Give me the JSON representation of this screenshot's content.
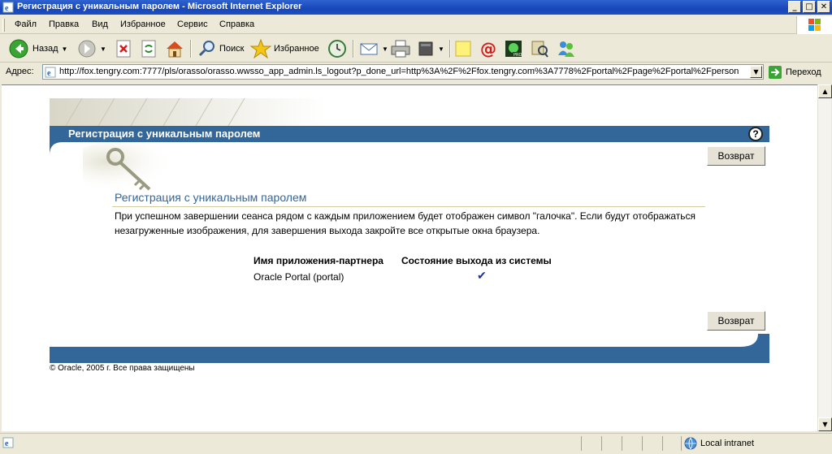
{
  "window": {
    "title": "Регистрация с уникальным паролем - Microsoft Internet Explorer",
    "controls": {
      "minimize": "_",
      "maximize": "□",
      "close": "✕"
    }
  },
  "menu": {
    "items": [
      "Файл",
      "Правка",
      "Вид",
      "Избранное",
      "Сервис",
      "Справка"
    ]
  },
  "toolbar": {
    "back_label": "Назад",
    "search_label": "Поиск",
    "favorites_label": "Избранное"
  },
  "address": {
    "label": "Адрес:",
    "url": "http://fox.tengry.com:7777/pls/orasso/orasso.wwsso_app_admin.ls_logout?p_done_url=http%3A%2F%2Ffox.tengry.com%3A7778%2Fportal%2Fpage%2Fportal%2Fperson",
    "go_label": "Переход"
  },
  "page": {
    "banner_title": "Регистрация с уникальным паролем",
    "help_glyph": "?",
    "back_button_label": "Возврат",
    "heading": "Регистрация с уникальным паролем",
    "description": "При успешном завершении сеанса рядом с каждым приложением будет отображен символ \"галочка\". Если будут отображаться незагруженные изображения, для завершения выхода закройте все открытые окна браузера.",
    "table": {
      "headers": [
        "Имя приложения-партнера",
        "Состояние выхода из системы"
      ],
      "rows": [
        {
          "app": "Oracle Portal (portal)",
          "status_glyph": "✔"
        }
      ]
    },
    "copyright": "© Oracle, 2005 г. Все права защищены"
  },
  "status": {
    "zone": "Local intranet"
  },
  "colors": {
    "brand_band": "#336699",
    "titlebar": "#1846b8",
    "checkmark": "#1f2f9a"
  }
}
